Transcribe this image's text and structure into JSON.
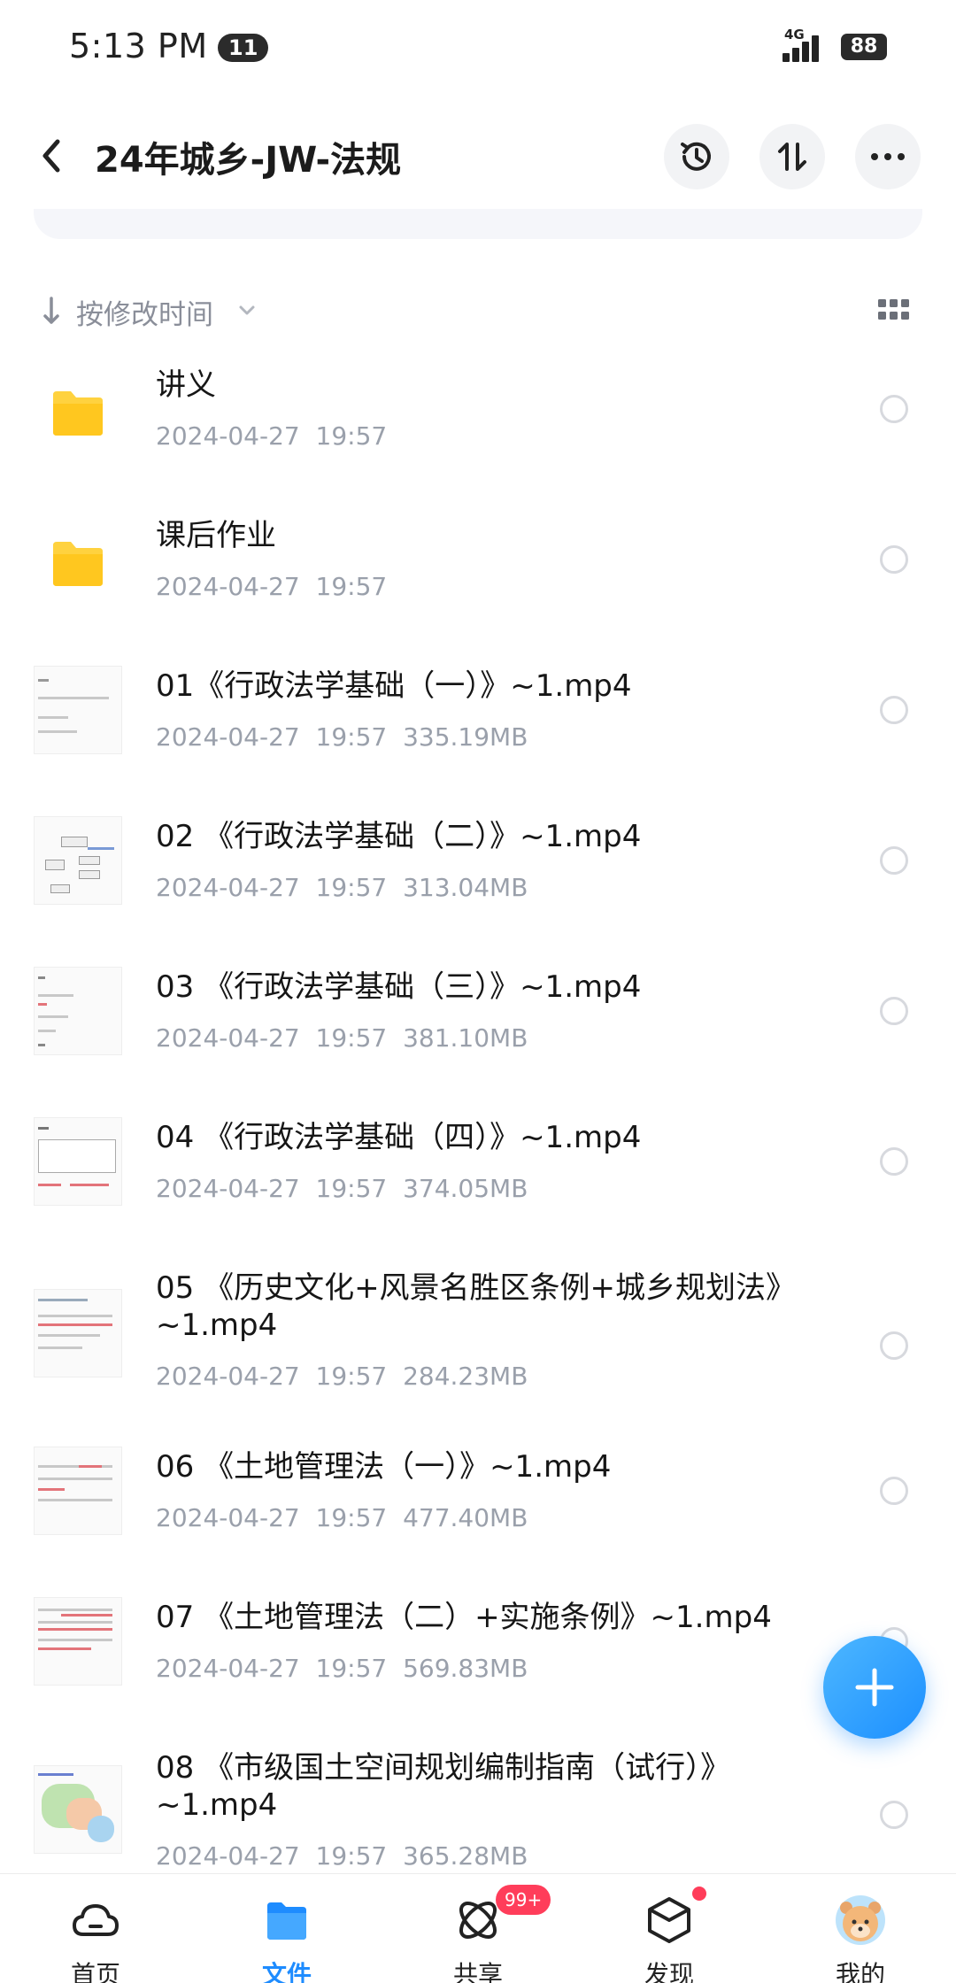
{
  "status_bar": {
    "time": "5:13 PM",
    "notification_count": "11",
    "network": "4G",
    "battery": "88"
  },
  "header": {
    "title": "24年城乡-JW-法规",
    "back_icon": "chevron-left-icon",
    "history_icon": "history-clock-icon",
    "transfer_icon": "transfer-arrows-icon",
    "more_icon": "more-dots-icon"
  },
  "sort": {
    "label": "按修改时间",
    "view_toggle_icon": "grid-view-icon"
  },
  "files": [
    {
      "name": "讲义",
      "date": "2024-04-27",
      "time": "19:57",
      "size": "",
      "type": "folder"
    },
    {
      "name": "课后作业",
      "date": "2024-04-27",
      "time": "19:57",
      "size": "",
      "type": "folder"
    },
    {
      "name": "01《行政法学基础（一）》~1.mp4",
      "date": "2024-04-27",
      "time": "19:57",
      "size": "335.19MB",
      "type": "video"
    },
    {
      "name": "02 《行政法学基础（二）》~1.mp4",
      "date": "2024-04-27",
      "time": "19:57",
      "size": "313.04MB",
      "type": "video"
    },
    {
      "name": "03 《行政法学基础（三）》~1.mp4",
      "date": "2024-04-27",
      "time": "19:57",
      "size": "381.10MB",
      "type": "video"
    },
    {
      "name": "04 《行政法学基础（四）》~1.mp4",
      "date": "2024-04-27",
      "time": "19:57",
      "size": "374.05MB",
      "type": "video"
    },
    {
      "name": "05 《历史文化+风景名胜区条例+城乡规划法》~1.mp4",
      "date": "2024-04-27",
      "time": "19:57",
      "size": "284.23MB",
      "type": "video"
    },
    {
      "name": "06 《土地管理法（一）》~1.mp4",
      "date": "2024-04-27",
      "time": "19:57",
      "size": "477.40MB",
      "type": "video"
    },
    {
      "name": "07 《土地管理法（二）+实施条例》~1.mp4",
      "date": "2024-04-27",
      "time": "19:57",
      "size": "569.83MB",
      "type": "video"
    },
    {
      "name": "08 《市级国土空间规划编制指南（试行）》~1.mp4",
      "date": "2024-04-27",
      "time": "19:57",
      "size": "365.28MB",
      "type": "video"
    }
  ],
  "fab": {
    "icon": "plus-icon"
  },
  "bottom_nav": [
    {
      "label": "首页",
      "icon": "cloud-home-icon",
      "active": false
    },
    {
      "label": "文件",
      "icon": "folder-icon",
      "active": true
    },
    {
      "label": "共享",
      "icon": "share-orbit-icon",
      "active": false,
      "badge": "99+"
    },
    {
      "label": "发现",
      "icon": "discover-cube-icon",
      "active": false
    },
    {
      "label": "我的",
      "icon": "avatar-icon",
      "active": false
    }
  ],
  "colors": {
    "accent": "#1e8cff",
    "folder": "#ffd23f",
    "badge": "#ff3d5a",
    "meta_text": "#9aa0ab"
  }
}
